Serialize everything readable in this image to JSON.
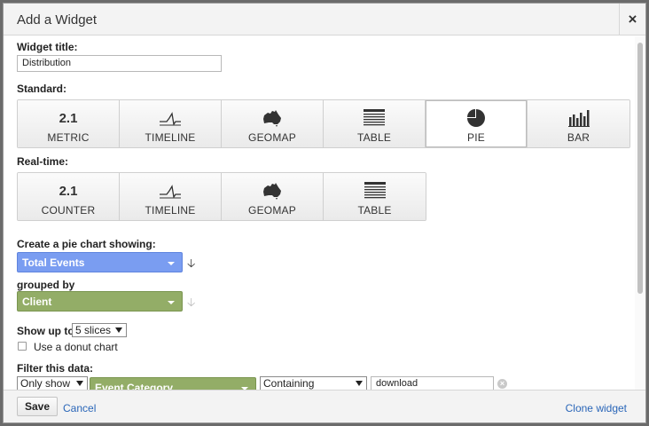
{
  "dialog": {
    "title": "Add a Widget",
    "close_glyph": "×"
  },
  "widget_title": {
    "label": "Widget title:",
    "value": "Distribution"
  },
  "standard": {
    "label": "Standard:",
    "tiles": [
      {
        "icon_text": "2.1",
        "label": "METRIC"
      },
      {
        "icon": "timeline-icon",
        "label": "TIMELINE"
      },
      {
        "icon": "geomap-icon",
        "label": "GEOMAP"
      },
      {
        "icon": "table-icon",
        "label": "TABLE"
      },
      {
        "icon": "pie-icon",
        "label": "PIE",
        "selected": true
      },
      {
        "icon": "bar-icon",
        "label": "BAR"
      }
    ]
  },
  "realtime": {
    "label": "Real-time:",
    "tiles": [
      {
        "icon_text": "2.1",
        "label": "COUNTER"
      },
      {
        "icon": "timeline-icon",
        "label": "TIMELINE"
      },
      {
        "icon": "geomap-icon",
        "label": "GEOMAP"
      },
      {
        "icon": "table-icon",
        "label": "TABLE"
      }
    ]
  },
  "pie_config": {
    "showing_label": "Create a pie chart showing:",
    "metric": "Total Events",
    "grouped_label": "grouped by",
    "dimension": "Client",
    "show_up_to_label": "Show up to",
    "slices": "5 slices",
    "donut_label": "Use a donut chart",
    "donut_checked": false
  },
  "filter": {
    "label": "Filter this data:",
    "mode": "Only show",
    "dimension": "Event Category",
    "match": "Containing",
    "value": "download"
  },
  "footer": {
    "save": "Save",
    "cancel": "Cancel",
    "clone": "Clone widget"
  },
  "colors": {
    "metric_dropdown": "#7a9df1",
    "dimension_dropdown": "#93ad67",
    "link": "#2a66b8"
  }
}
